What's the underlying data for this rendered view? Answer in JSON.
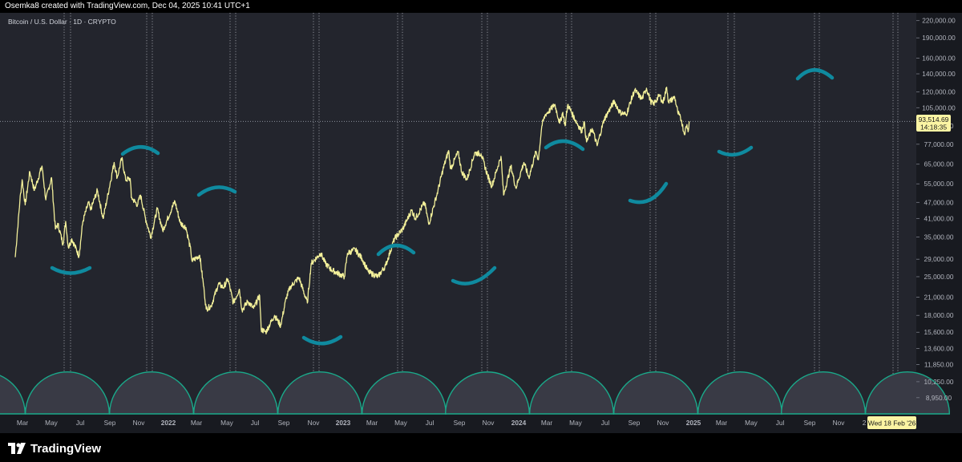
{
  "header": {
    "caption": "Osemka8 created with TradingView.com, Dec 04, 2025 10:41 UTC+1"
  },
  "chart_title": "Bitcoin / U.S. Dollar · 1D · CRYPTO",
  "footer": {
    "brand": "TradingView"
  },
  "colors": {
    "background": "#23252d",
    "price_line": "#f3f09a",
    "cycle_arc": "#0f8a9f",
    "half_circle": "#1aa98a",
    "price_label_bg": "#fbf4a3"
  },
  "price_label": {
    "price": "93,514.69",
    "countdown": "14:18:35"
  },
  "crosshair_date_label": "Wed 18 Feb '26",
  "chart_data": {
    "type": "line",
    "title": "Bitcoin / U.S. Dollar · 1D · CRYPTO",
    "scale": "log",
    "ylim": [
      7800,
      235000
    ],
    "y_ticks": [
      "220,000.00",
      "190,000.00",
      "160,000.00",
      "140,000.00",
      "120,000.00",
      "105,000.00",
      "90,000.00",
      "77,000.00",
      "65,000.00",
      "55,000.00",
      "47,000.00",
      "41,000.00",
      "35,000.00",
      "29,000.00",
      "25,000.00",
      "21,000.00",
      "18,000.00",
      "15,600.00",
      "13,600.00",
      "11,850.00",
      "10,250.00",
      "8,950.00"
    ],
    "x_ticks": [
      "Mar",
      "May",
      "Jul",
      "Sep",
      "Nov",
      "2022",
      "Mar",
      "May",
      "Jul",
      "Sep",
      "Nov",
      "2023",
      "Mar",
      "May",
      "Jul",
      "Sep",
      "Nov",
      "2024",
      "Mar",
      "May",
      "Jul",
      "Sep",
      "Nov",
      "2025",
      "Mar",
      "May",
      "Jul",
      "Sep",
      "Nov",
      "2"
    ],
    "series": [
      {
        "values": [
          [
            "2021-02-03",
            29500
          ],
          [
            "2021-02-15",
            47500
          ],
          [
            "2021-02-21",
            57000
          ],
          [
            "2021-03-01",
            46000
          ],
          [
            "2021-03-13",
            61000
          ],
          [
            "2021-03-25",
            52000
          ],
          [
            "2021-04-14",
            64000
          ],
          [
            "2021-04-24",
            48000
          ],
          [
            "2021-05-09",
            58000
          ],
          [
            "2021-05-19",
            37500
          ],
          [
            "2021-05-26",
            39000
          ],
          [
            "2021-06-08",
            33000
          ],
          [
            "2021-06-15",
            40000
          ],
          [
            "2021-06-22",
            32000
          ],
          [
            "2021-07-01",
            34500
          ],
          [
            "2021-07-20",
            29800
          ],
          [
            "2021-07-30",
            40000
          ],
          [
            "2021-08-14",
            47000
          ],
          [
            "2021-08-19",
            44000
          ],
          [
            "2021-09-06",
            52000
          ],
          [
            "2021-09-21",
            41000
          ],
          [
            "2021-10-01",
            48000
          ],
          [
            "2021-10-20",
            66000
          ],
          [
            "2021-10-28",
            58000
          ],
          [
            "2021-11-09",
            68500
          ],
          [
            "2021-11-19",
            57000
          ],
          [
            "2021-12-01",
            57500
          ],
          [
            "2021-12-04",
            49000
          ],
          [
            "2021-12-20",
            46000
          ],
          [
            "2021-12-28",
            50000
          ],
          [
            "2022-01-10",
            41000
          ],
          [
            "2022-01-24",
            35000
          ],
          [
            "2022-02-10",
            44500
          ],
          [
            "2022-02-24",
            37000
          ],
          [
            "2022-03-28",
            47500
          ],
          [
            "2022-04-11",
            39500
          ],
          [
            "2022-04-26",
            38000
          ],
          [
            "2022-05-09",
            31000
          ],
          [
            "2022-05-12",
            28500
          ],
          [
            "2022-06-01",
            30000
          ],
          [
            "2022-06-13",
            22000
          ],
          [
            "2022-06-18",
            19000
          ],
          [
            "2022-07-01",
            19500
          ],
          [
            "2022-07-20",
            23500
          ],
          [
            "2022-08-02",
            22800
          ],
          [
            "2022-08-14",
            24500
          ],
          [
            "2022-08-28",
            20000
          ],
          [
            "2022-09-13",
            22500
          ],
          [
            "2022-09-20",
            18800
          ],
          [
            "2022-10-05",
            20300
          ],
          [
            "2022-10-20",
            19100
          ],
          [
            "2022-11-05",
            21300
          ],
          [
            "2022-11-09",
            16000
          ],
          [
            "2022-11-21",
            15600
          ],
          [
            "2022-12-14",
            18000
          ],
          [
            "2022-12-30",
            16500
          ],
          [
            "2023-01-14",
            21000
          ],
          [
            "2023-01-25",
            23000
          ],
          [
            "2023-02-16",
            24800
          ],
          [
            "2023-03-10",
            20000
          ],
          [
            "2023-03-20",
            28000
          ],
          [
            "2023-04-14",
            30500
          ],
          [
            "2023-04-26",
            28000
          ],
          [
            "2023-05-12",
            26500
          ],
          [
            "2023-06-15",
            25000
          ],
          [
            "2023-06-23",
            30500
          ],
          [
            "2023-07-13",
            31500
          ],
          [
            "2023-07-31",
            29200
          ],
          [
            "2023-08-17",
            26000
          ],
          [
            "2023-09-11",
            25000
          ],
          [
            "2023-10-01",
            27500
          ],
          [
            "2023-10-24",
            34500
          ],
          [
            "2023-11-15",
            37500
          ],
          [
            "2023-12-08",
            44000
          ],
          [
            "2023-12-18",
            41000
          ],
          [
            "2024-01-11",
            47000
          ],
          [
            "2024-01-22",
            39000
          ],
          [
            "2024-02-15",
            52000
          ],
          [
            "2024-02-28",
            62000
          ],
          [
            "2024-03-14",
            73000
          ],
          [
            "2024-03-19",
            62500
          ],
          [
            "2024-04-08",
            72000
          ],
          [
            "2024-04-17",
            61000
          ],
          [
            "2024-05-01",
            57000
          ],
          [
            "2024-05-21",
            71500
          ],
          [
            "2024-06-07",
            71000
          ],
          [
            "2024-06-24",
            59000
          ],
          [
            "2024-07-05",
            54000
          ],
          [
            "2024-07-29",
            69500
          ],
          [
            "2024-08-05",
            50000
          ],
          [
            "2024-08-24",
            64000
          ],
          [
            "2024-09-06",
            53000
          ],
          [
            "2024-09-27",
            66000
          ],
          [
            "2024-10-10",
            58000
          ],
          [
            "2024-10-29",
            72500
          ],
          [
            "2024-11-04",
            67500
          ],
          [
            "2024-11-13",
            90000
          ],
          [
            "2024-11-22",
            99000
          ],
          [
            "2024-12-05",
            103000
          ],
          [
            "2024-12-17",
            108000
          ],
          [
            "2024-12-30",
            92000
          ],
          [
            "2025-01-07",
            101000
          ],
          [
            "2025-01-13",
            90000
          ],
          [
            "2025-01-20",
            108000
          ],
          [
            "2025-02-03",
            98000
          ],
          [
            "2025-02-25",
            86000
          ],
          [
            "2025-03-04",
            93000
          ],
          [
            "2025-03-10",
            78500
          ],
          [
            "2025-03-25",
            88000
          ],
          [
            "2025-04-07",
            76000
          ],
          [
            "2025-04-25",
            95000
          ],
          [
            "2025-05-22",
            111000
          ],
          [
            "2025-06-05",
            101000
          ],
          [
            "2025-06-22",
            99000
          ],
          [
            "2025-07-14",
            122000
          ],
          [
            "2025-08-02",
            113000
          ],
          [
            "2025-08-14",
            124000
          ],
          [
            "2025-08-25",
            111000
          ],
          [
            "2025-09-01",
            108000
          ],
          [
            "2025-09-18",
            117000
          ],
          [
            "2025-09-26",
            109000
          ],
          [
            "2025-10-06",
            125000
          ],
          [
            "2025-10-11",
            110000
          ],
          [
            "2025-10-27",
            115000
          ],
          [
            "2025-11-04",
            101000
          ],
          [
            "2025-11-14",
            94000
          ],
          [
            "2025-11-21",
            84000
          ],
          [
            "2025-11-28",
            91000
          ],
          [
            "2025-12-01",
            85500
          ],
          [
            "2025-12-04",
            93514.69
          ]
        ]
      }
    ]
  }
}
